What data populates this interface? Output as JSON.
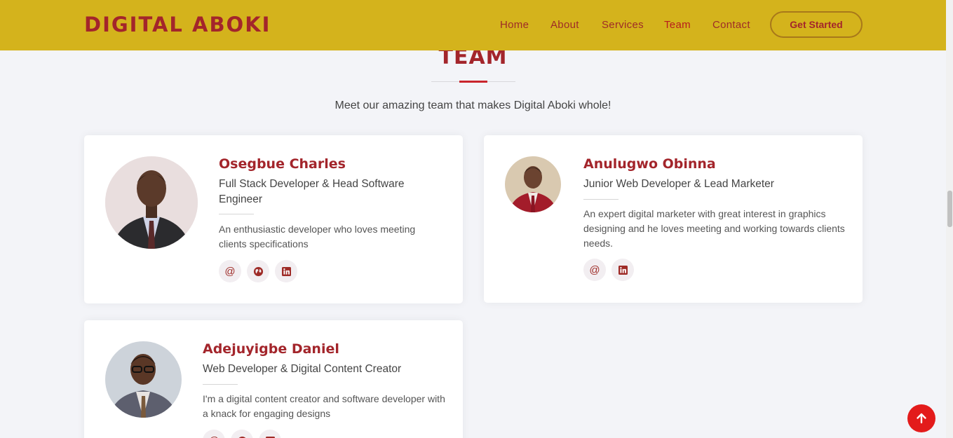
{
  "header": {
    "logo": "DIGITAL ABOKI",
    "nav": [
      {
        "label": "Home"
      },
      {
        "label": "About"
      },
      {
        "label": "Services"
      },
      {
        "label": "Team"
      },
      {
        "label": "Contact"
      }
    ],
    "cta": "Get Started",
    "active_nav": "Team"
  },
  "section": {
    "title": "TEAM",
    "subtitle": "Meet our amazing team that makes Digital Aboki whole!"
  },
  "team": [
    {
      "name": "Osegbue Charles",
      "role": "Full Stack Developer & Head Software Engineer",
      "description": "An enthusiastic developer who loves meeting clients specifications",
      "socials": [
        "email-icon",
        "globe-icon",
        "linkedin-icon"
      ]
    },
    {
      "name": "Anulugwo Obinna",
      "role": "Junior Web Developer & Lead Marketer",
      "description": "An expert digital marketer with great interest in graphics designing and he loves meeting and working towards clients needs.",
      "socials": [
        "email-icon",
        "linkedin-icon"
      ]
    },
    {
      "name": "Adejuyigbe Daniel",
      "role": "Web Developer & Digital Content Creator",
      "description": "I'm a digital content creator and software developer with a knack for engaging designs",
      "socials": [
        "email-icon",
        "globe-icon",
        "linkedin-icon"
      ]
    }
  ],
  "colors": {
    "header_bg": "#d4b31c",
    "brand_red": "#a3252b",
    "page_bg": "#f3f4f8",
    "back_to_top": "#e31b1b"
  }
}
